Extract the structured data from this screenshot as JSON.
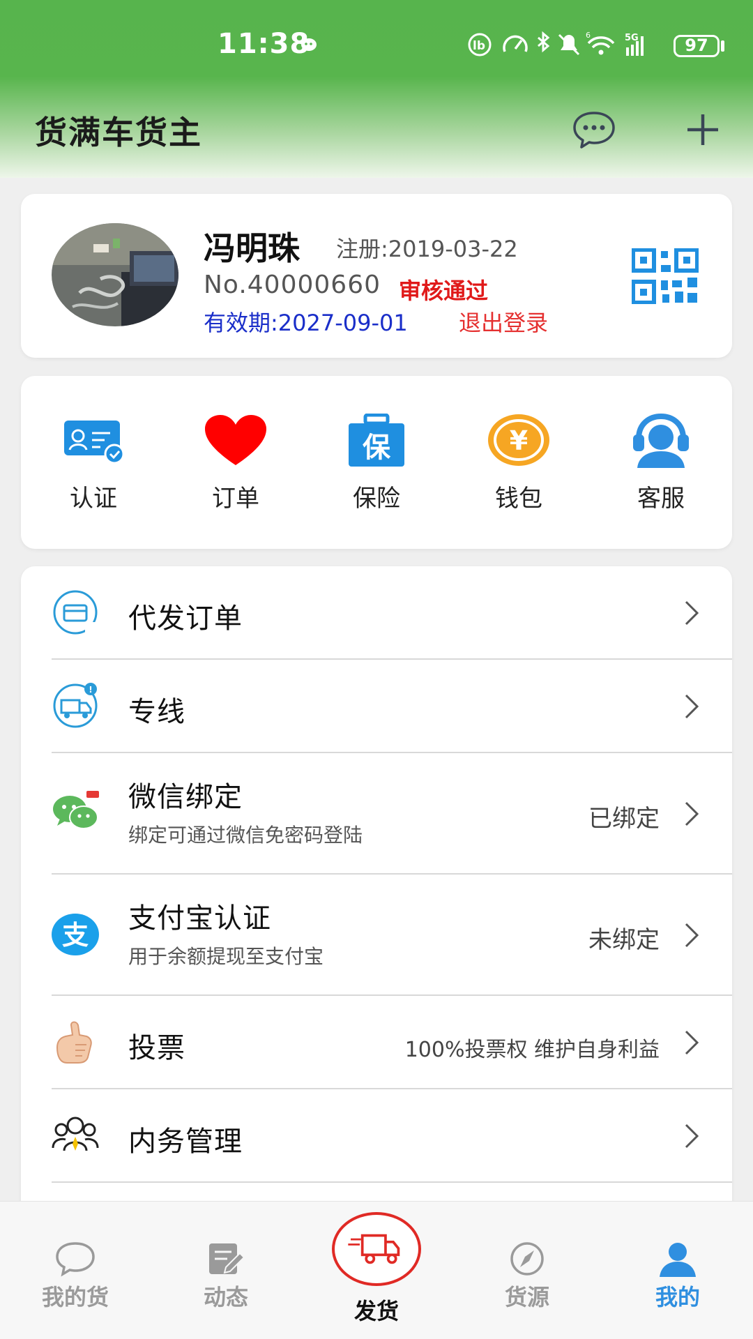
{
  "status_bar": {
    "time": "11:38",
    "battery": "97",
    "network": "5G"
  },
  "header": {
    "title": "货满车货主"
  },
  "profile": {
    "name": "冯明珠",
    "registered": "注册:2019-03-22",
    "number": "No.40000660",
    "audit_status": "审核通过",
    "valid_until": "有效期:2027-09-01",
    "logout": "退出登录"
  },
  "quick_actions": [
    {
      "label": "认证",
      "icon": "id-card-icon"
    },
    {
      "label": "订单",
      "icon": "heart-icon"
    },
    {
      "label": "保险",
      "icon": "insurance-bag-icon"
    },
    {
      "label": "钱包",
      "icon": "yuan-coin-icon"
    },
    {
      "label": "客服",
      "icon": "customer-service-icon"
    }
  ],
  "menu": [
    {
      "title": "代发订单",
      "subtitle": "",
      "right": "",
      "icon": "proxy-order-icon"
    },
    {
      "title": "专线",
      "subtitle": "",
      "right": "",
      "icon": "dedicated-line-truck-icon"
    },
    {
      "title": "微信绑定",
      "subtitle": "绑定可通过微信免密码登陆",
      "right": "已绑定",
      "icon": "wechat-icon"
    },
    {
      "title": "支付宝认证",
      "subtitle": "用于余额提现至支付宝",
      "right": "未绑定",
      "icon": "alipay-icon"
    },
    {
      "title": "投票",
      "subtitle": "",
      "right": "100%投票权  维护自身利益",
      "icon": "thumbs-up-icon"
    },
    {
      "title": "内务管理",
      "subtitle": "",
      "right": "",
      "icon": "team-management-icon"
    }
  ],
  "tabbar": {
    "tabs": [
      {
        "label": "我的货",
        "icon": "chat-bubble-icon"
      },
      {
        "label": "动态",
        "icon": "edit-note-icon"
      },
      {
        "label": "发货",
        "icon": "delivery-truck-icon"
      },
      {
        "label": "货源",
        "icon": "compass-icon"
      },
      {
        "label": "我的",
        "icon": "user-icon"
      }
    ],
    "active": "我的"
  },
  "colors": {
    "header_green": "#57b44d",
    "accent_red": "#e01a1a",
    "link_blue": "#1a2ec9",
    "active_tab_blue": "#2f8fe0"
  }
}
